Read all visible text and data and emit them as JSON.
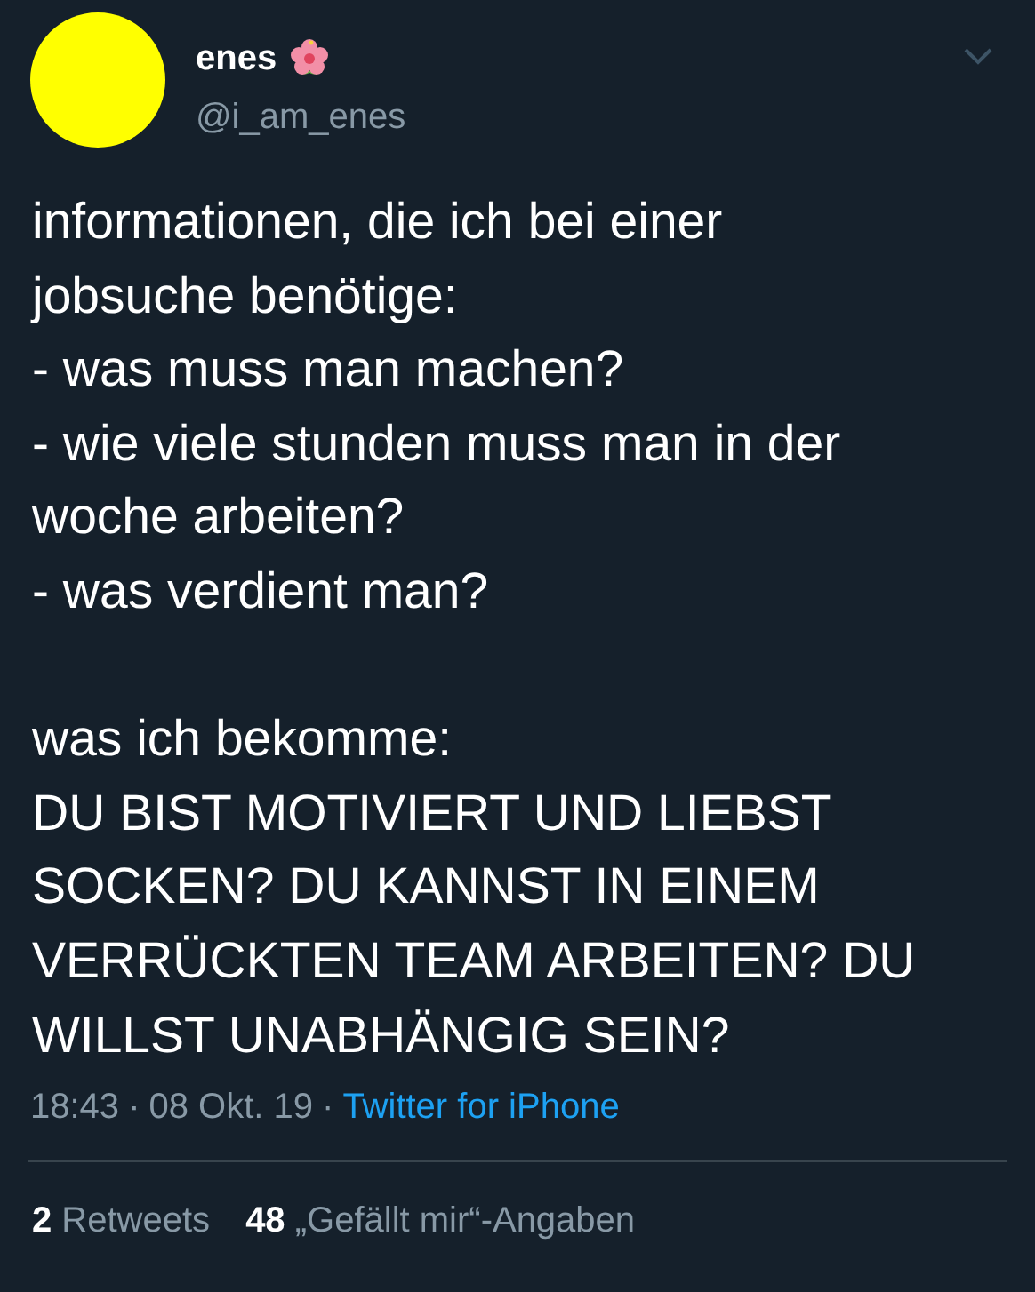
{
  "author": {
    "name": "enes",
    "handle": "@i_am_enes"
  },
  "tweet_paragraphs": [
    [
      "informationen, die ich bei einer",
      "jobsuche benötige:",
      "- was muss man machen?",
      "- wie viele stunden muss man in der",
      "woche arbeiten?",
      "- was verdient man?"
    ],
    [
      "was ich bekomme:",
      "DU BIST MOTIVIERT UND LIEBST",
      "SOCKEN? DU KANNST IN EINEM",
      "VERRÜCKTEN TEAM ARBEITEN? DU",
      "WILLST UNABHÄNGIG SEIN?"
    ]
  ],
  "meta": [
    {
      "kind": "time",
      "text": "18:43"
    },
    {
      "kind": "separator",
      "text": "·"
    },
    {
      "kind": "date",
      "text": "08 Okt. 19"
    },
    {
      "kind": "separator",
      "text": "·"
    },
    {
      "kind": "link",
      "text": "Twitter for iPhone"
    }
  ],
  "stats": [
    "**2** Retweets",
    "**48** „Gefällt mir“-Angaben"
  ]
}
